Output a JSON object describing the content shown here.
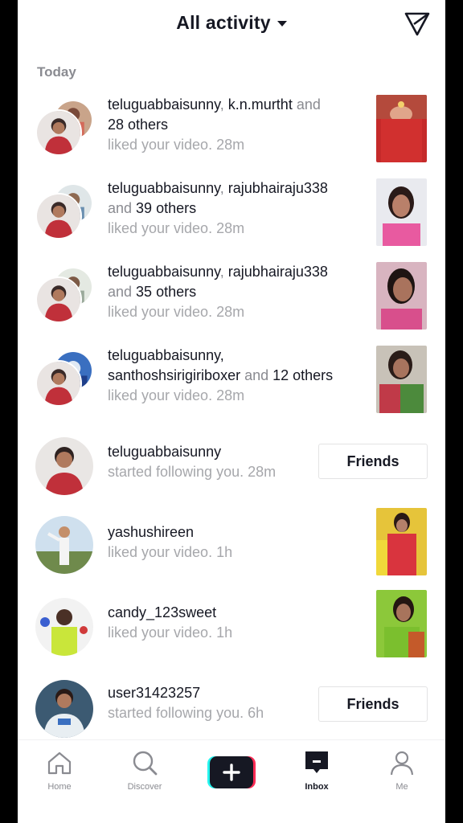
{
  "header": {
    "title": "All activity",
    "send_icon": "send-icon"
  },
  "section": {
    "label": "Today"
  },
  "activities": [
    {
      "users": [
        "teluguabbaisunny",
        "k.n.murtht"
      ],
      "line1_user1": "teluguabbaisunny",
      "line1_sep": ", ",
      "line1_user2": "k.n.murtht",
      "line1_and": " and",
      "line2_count": "28 others",
      "action": "liked your video.",
      "time": " 28m"
    },
    {
      "line1_user1": "teluguabbaisunny",
      "line1_sep": ", ",
      "line1_user2": "rajubhairaju338",
      "line2_and": "and ",
      "line2_count": "39 others",
      "action": "liked your video.",
      "time": " 28m"
    },
    {
      "line1_user1": "teluguabbaisunny",
      "line1_sep": ", ",
      "line1_user2": "rajubhairaju338",
      "line2_and": "and ",
      "line2_count": "35 others",
      "action": "liked your video.",
      "time": " 28m"
    },
    {
      "line1_user1": "teluguabbaisunny,",
      "line2_user2": "santhoshsirigiriboxer",
      "line2_and": " and ",
      "line2_count": "12 others",
      "action": "liked your video.",
      "time": " 28m"
    },
    {
      "user": "teluguabbaisunny",
      "action": "started following you.",
      "time": " 28m",
      "button": "Friends"
    },
    {
      "user": "yashushireen",
      "action": "liked your video.",
      "time": " 1h"
    },
    {
      "user": "candy_123sweet",
      "action": "liked your video.",
      "time": " 1h"
    },
    {
      "user": "user31423257",
      "action": "started following you.",
      "time": " 6h",
      "button": "Friends"
    }
  ],
  "nav": {
    "home": "Home",
    "discover": "Discover",
    "create": "create-plus-icon",
    "inbox": "Inbox",
    "me": "Me"
  },
  "colors": {
    "accent_cyan": "#25f4ee",
    "accent_red": "#fe2c55",
    "text": "#161823",
    "muted": "#8a8b91"
  }
}
